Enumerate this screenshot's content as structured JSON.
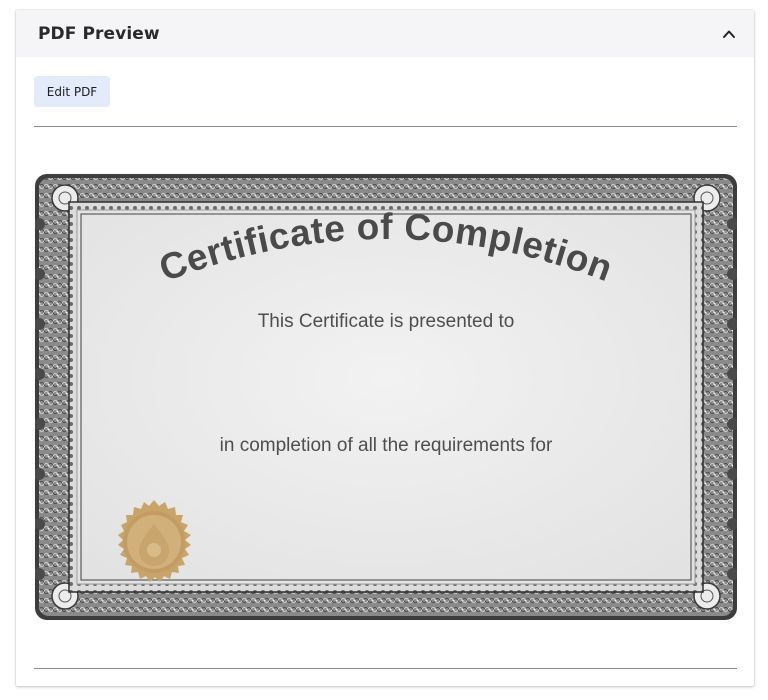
{
  "panel": {
    "title": "PDF Preview",
    "collapse_icon": "chevron-up-icon",
    "edit_button_label": "Edit PDF"
  },
  "certificate": {
    "title": "Certificate of Completion",
    "presented_to": "This Certificate is presented to",
    "completion_text": "in completion of all the requirements for",
    "seal_icon": "drop-seal-icon",
    "colors": {
      "border": "#5a5a5a",
      "paper": "#eeeeee",
      "title_text": "#4a4a4a",
      "seal": "#c9a56a"
    }
  },
  "colors": {
    "header_bg": "#f5f5f7",
    "button_bg": "#e3ebfa",
    "divider": "#8b8b95"
  }
}
